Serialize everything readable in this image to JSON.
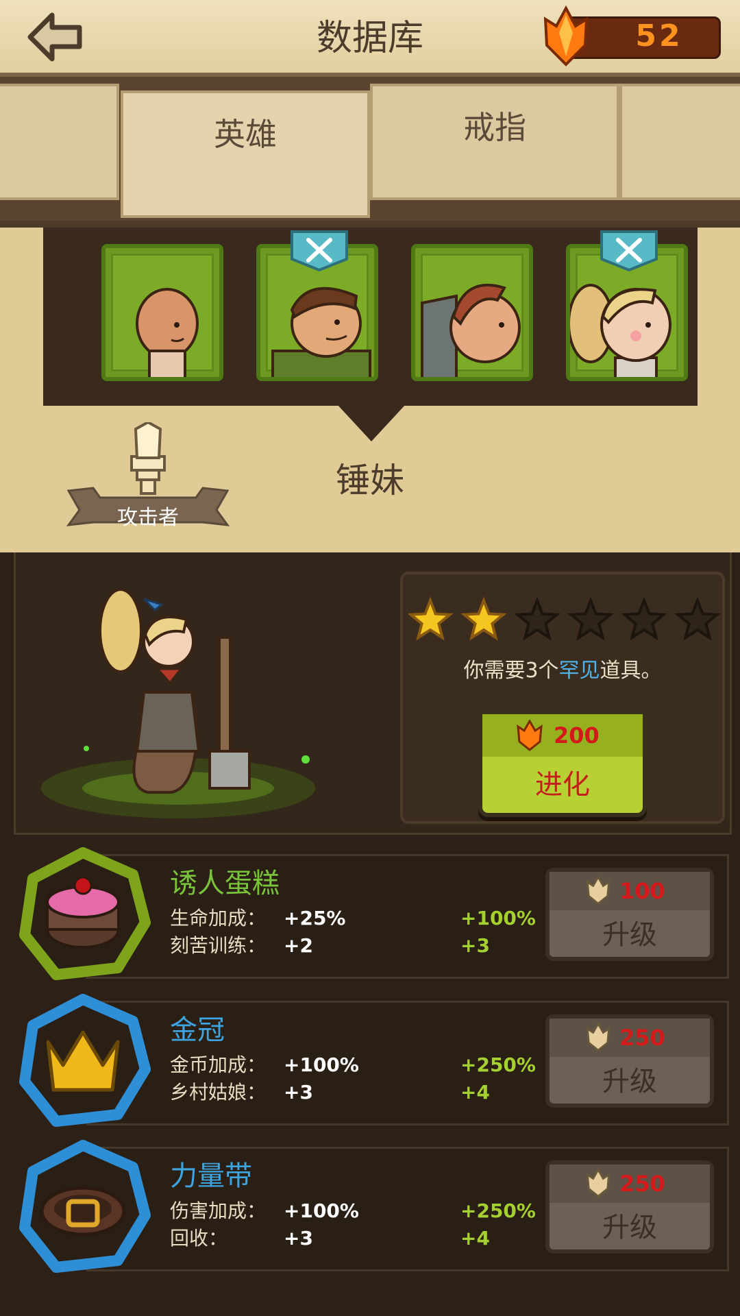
{
  "header": {
    "title": "数据库",
    "gems": "52"
  },
  "tabs": [
    {
      "label": ""
    },
    {
      "label": "英雄"
    },
    {
      "label": "戒指"
    },
    {
      "label": ""
    }
  ],
  "hero": {
    "name": "锤妹",
    "class_label": "攻击者",
    "stars_filled": 2,
    "stars_total": 6,
    "requirement": {
      "prefix": "你需要",
      "count": "3个",
      "rarity": "罕见",
      "suffix": "道具。"
    },
    "evolve": {
      "cost": "200",
      "label": "进化"
    }
  },
  "items": [
    {
      "name": "诱人蛋糕",
      "name_color": "#79c43a",
      "ring_color": "#7ea41c",
      "stats": [
        {
          "label": "生命加成：",
          "value": "+25%",
          "next": "+100%"
        },
        {
          "label": "刻苦训练：",
          "value": "+2",
          "next": "+3"
        }
      ],
      "upgrade": {
        "cost": "100",
        "label": "升级"
      }
    },
    {
      "name": "金冠",
      "name_color": "#3ea4df",
      "ring_color": "#2e8fd6",
      "stats": [
        {
          "label": "金币加成：",
          "value": "+100%",
          "next": "+250%"
        },
        {
          "label": "乡村姑娘：",
          "value": "+3",
          "next": "+4"
        }
      ],
      "upgrade": {
        "cost": "250",
        "label": "升级"
      }
    },
    {
      "name": "力量带",
      "name_color": "#3ea4df",
      "ring_color": "#2e8fd6",
      "stats": [
        {
          "label": "伤害加成：",
          "value": "+100%",
          "next": "+250%"
        },
        {
          "label": "回收：",
          "value": "+3",
          "next": "+4"
        }
      ],
      "upgrade": {
        "cost": "250",
        "label": "升级"
      }
    }
  ]
}
